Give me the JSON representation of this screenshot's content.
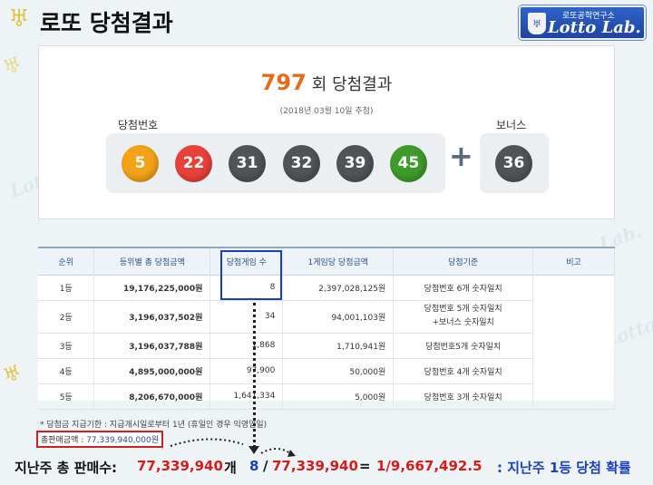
{
  "header": {
    "title": "로또 당첨결과",
    "logo_sub": "로또공학연구소",
    "logo_main": "Lotto Lab."
  },
  "draw": {
    "number": "797",
    "suffix": "회 당첨결과",
    "date": "(2018년 03월 10일 추첨)",
    "win_label": "당첨번호",
    "bonus_label": "보너스",
    "numbers": [
      "5",
      "22",
      "31",
      "32",
      "39",
      "45"
    ],
    "bonus": "36",
    "plus": "+",
    "colors": {
      "yellow": "#f3a318",
      "red": "#e8413a",
      "gray": "#505458",
      "green": "#3e9b2b"
    }
  },
  "table": {
    "headers": [
      "순위",
      "등위별 총 당첨금액",
      "당첨게임 수",
      "1게임당 당첨금액",
      "당첨기준",
      "비고"
    ],
    "rows": [
      {
        "rank": "1등",
        "total": "19,176,225,000원",
        "count": "8",
        "per": "2,397,028,125원",
        "crit": "당첨번호 6개 숫자일치",
        "crit2": ""
      },
      {
        "rank": "2등",
        "total": "3,196,037,502원",
        "count": "34",
        "per": "94,001,103원",
        "crit": "당첨번호 5개 숫자일치",
        "crit2": "+보너스 숫자일치"
      },
      {
        "rank": "3등",
        "total": "3,196,037,788원",
        "count": "1,868",
        "per": "1,710,941원",
        "crit": "당첨번호5개 숫자일치",
        "crit2": ""
      },
      {
        "rank": "4등",
        "total": "4,895,000,000원",
        "count": "97,900",
        "per": "50,000원",
        "crit": "당첨번호 4개 숫자일치",
        "crit2": ""
      },
      {
        "rank": "5등",
        "total": "8,206,670,000원",
        "count": "1,641,334",
        "per": "5,000원",
        "crit": "당첨번호 3개 숫자일치",
        "crit2": ""
      }
    ]
  },
  "note": "* 당첨금 지급기한 : 지급개시일로부터 1년 (휴일인 경우 익영업일)",
  "sales": {
    "label": "총판매금액 : ",
    "value": "77,339,940,000원"
  },
  "bottom": {
    "label": "지난주 총 판매수:",
    "total": "77,339,940",
    "unit": "개",
    "win": "8",
    "slash": "/",
    "denom": "77,339,940",
    "eq": "=",
    "ratio": "1/9,667,492.5",
    "desc": ": 지난주 1등 당첨 확률"
  }
}
